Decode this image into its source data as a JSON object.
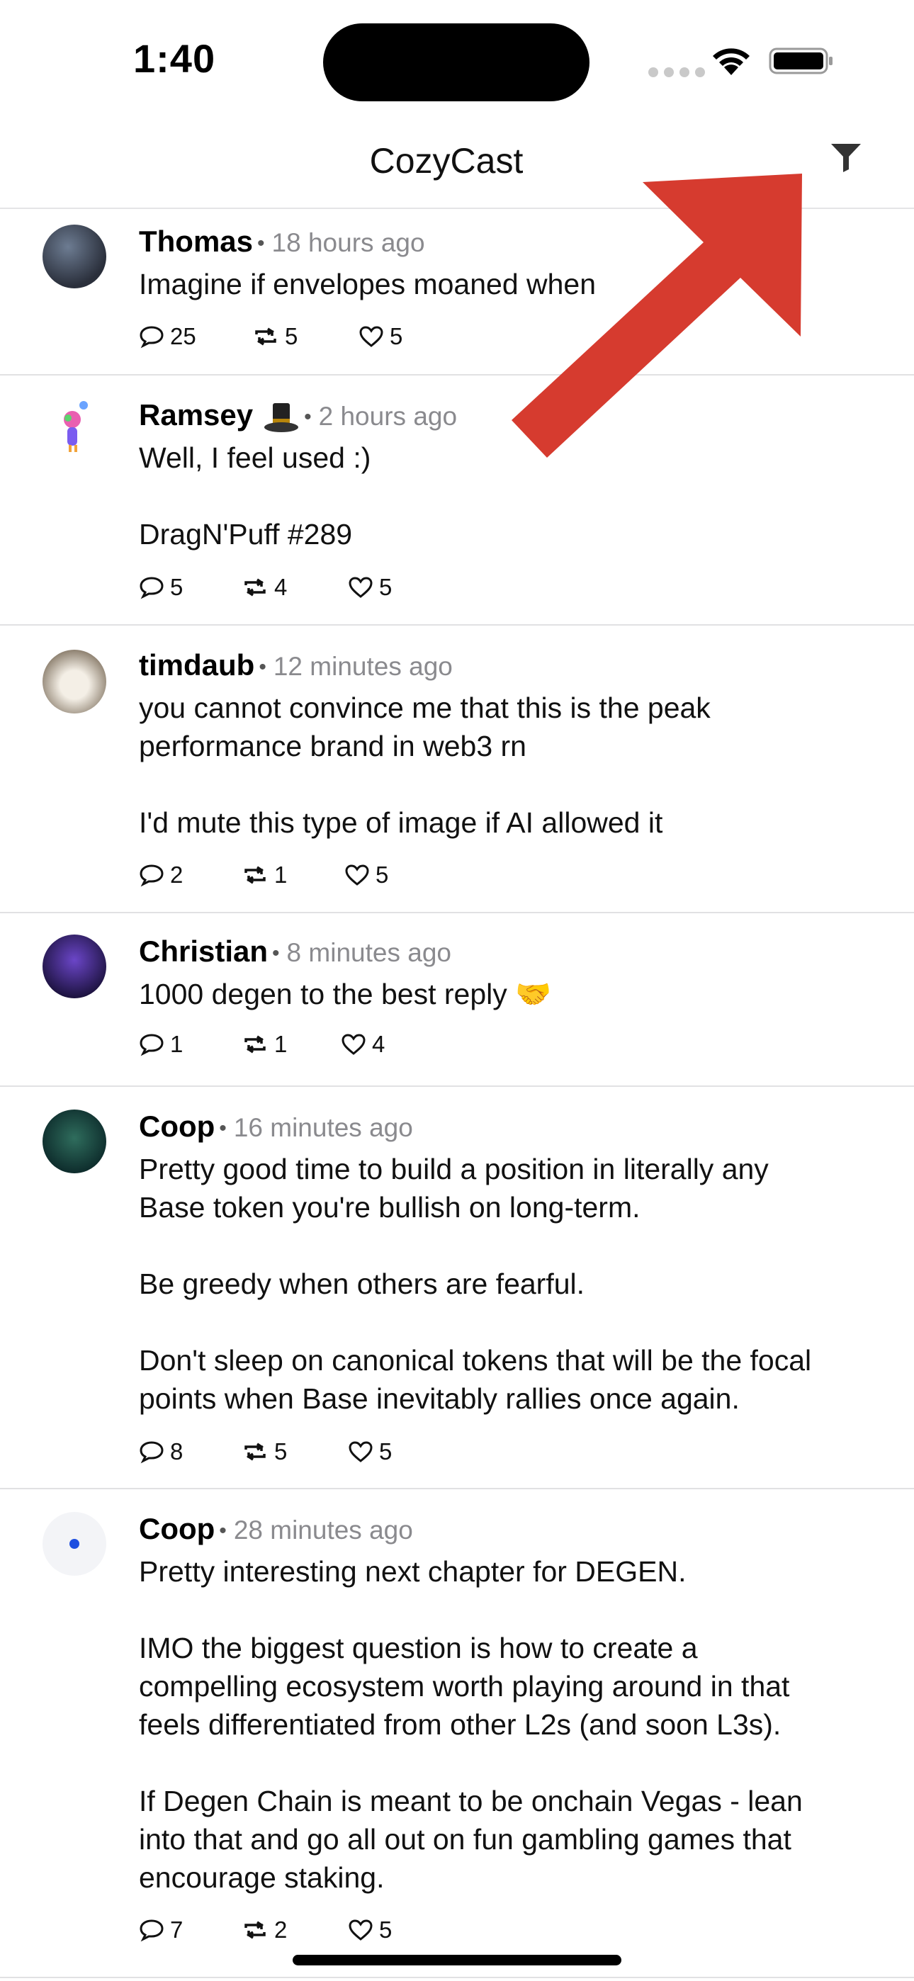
{
  "status_bar": {
    "time": "1:40"
  },
  "header": {
    "title": "CozyCast",
    "filter_icon": "filter-icon"
  },
  "posts": [
    {
      "author": "Thomas",
      "ago": "18 hours ago",
      "text": "Imagine if envelopes moaned when",
      "replies": "25",
      "recasts": "5",
      "likes": "5"
    },
    {
      "author": "Ramsey",
      "ago": "2 hours ago",
      "badge": "top-hat-icon",
      "text": "Well, I feel used :)\n\nDragN'Puff #289",
      "replies": "5",
      "recasts": "4",
      "likes": "5"
    },
    {
      "author": "timdaub",
      "ago": "12 minutes ago",
      "text": "you cannot convince me that this is the peak\nperformance brand in web3 rn\n\nI'd mute this type of image if AI allowed it",
      "replies": "2",
      "recasts": "1",
      "likes": "5"
    },
    {
      "author": "Christian",
      "ago": "8 minutes ago",
      "text": "1000 degen to the best reply 🤝",
      "replies": "1",
      "recasts": "1",
      "likes": "4"
    },
    {
      "author": "Coop",
      "ago": "16 minutes ago",
      "text": "Pretty good time to build a position in literally any\nBase token you're bullish on long-term.\n\nBe greedy when others are fearful.\n\nDon't sleep on canonical tokens that will be the focal\npoints when Base inevitably rallies once again.",
      "replies": "8",
      "recasts": "5",
      "likes": "5"
    },
    {
      "author": "Coop",
      "ago": "28 minutes ago",
      "text": "Pretty interesting next chapter for DEGEN.\n\nIMO the biggest question is how to create a\ncompelling ecosystem worth playing around in that\nfeels differentiated from other L2s (and soon L3s).\n\nIf Degen Chain is meant to be onchain Vegas - lean\ninto that and go all out on fun gambling games that\nencourage staking.",
      "replies": "7",
      "recasts": "2",
      "likes": "5"
    }
  ],
  "colors": {
    "arrow": "#d63b2f",
    "divider": "#e1e1e3",
    "muted": "#8a8a8e"
  }
}
